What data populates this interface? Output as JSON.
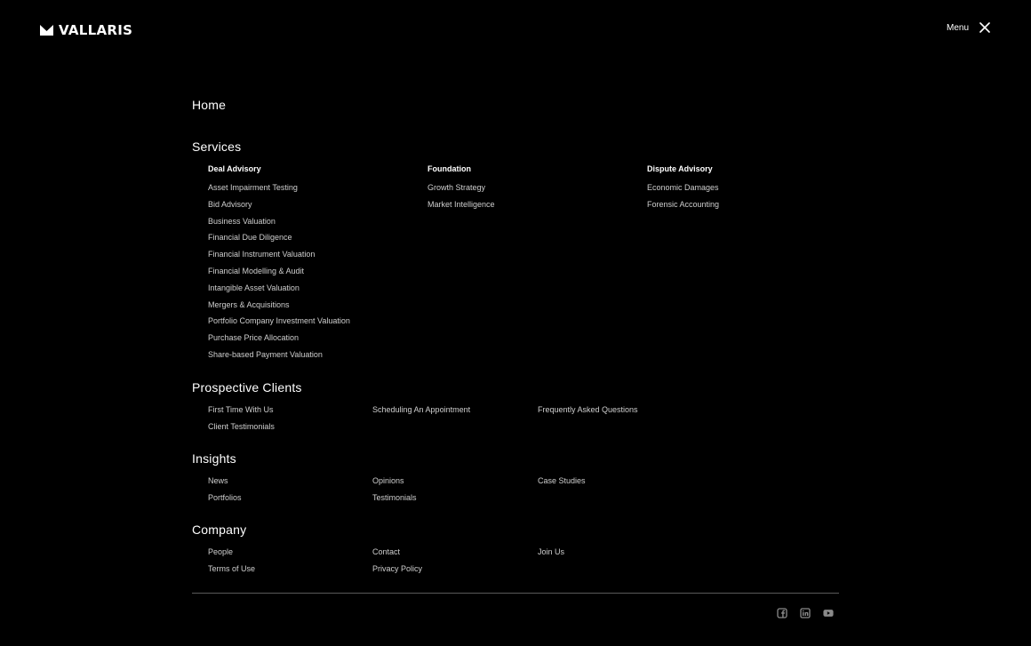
{
  "header": {
    "logo_text": "VALLARIS",
    "menu_label": "Menu"
  },
  "nav": {
    "home": "Home",
    "services": {
      "title": "Services",
      "deal_advisory": {
        "heading": "Deal Advisory",
        "items": [
          "Asset Impairment Testing",
          "Bid Advisory",
          "Business Valuation",
          "Financial Due Diligence",
          "Financial Instrument Valuation",
          "Financial Modelling & Audit",
          "Intangible Asset Valuation",
          "Mergers & Acquisitions",
          "Portfolio Company Investment Valuation",
          "Purchase Price Allocation",
          "Share-based Payment Valuation"
        ]
      },
      "foundation": {
        "heading": "Foundation",
        "items": [
          "Growth Strategy",
          "Market Intelligence"
        ]
      },
      "dispute_advisory": {
        "heading": "Dispute Advisory",
        "items": [
          "Economic Damages",
          "Forensic Accounting"
        ]
      }
    },
    "prospective_clients": {
      "title": "Prospective Clients",
      "col1": [
        "First Time With Us",
        "Client Testimonials"
      ],
      "col2": [
        "Scheduling An Appointment"
      ],
      "col3": [
        "Frequently Asked Questions"
      ]
    },
    "insights": {
      "title": "Insights",
      "col1": [
        "News",
        "Portfolios"
      ],
      "col2": [
        "Opinions",
        "Testimonials"
      ],
      "col3": [
        "Case Studies"
      ]
    },
    "company": {
      "title": "Company",
      "col1": [
        "People",
        "Terms of Use"
      ],
      "col2": [
        "Contact",
        "Privacy Policy"
      ],
      "col3": [
        "Join Us"
      ]
    }
  },
  "footer": {
    "socials": [
      "facebook-icon",
      "linkedin-icon",
      "youtube-icon"
    ]
  }
}
